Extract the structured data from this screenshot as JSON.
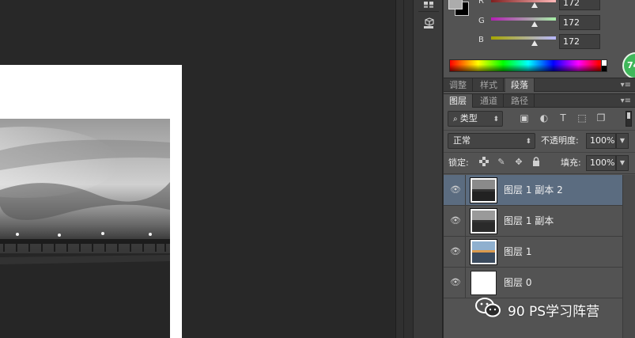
{
  "color_panel": {
    "foreground_color": "#acacac",
    "background_color": "#000000",
    "channels": [
      {
        "label": "R",
        "value": "172",
        "track_from": "#7f1f1f",
        "track_to": "#ffb8b8",
        "level": 0.674
      },
      {
        "label": "G",
        "value": "172",
        "track_from": "#b31fb3",
        "track_to": "#a6f0a6",
        "level": 0.674
      },
      {
        "label": "B",
        "value": "172",
        "track_from": "#a6a600",
        "track_to": "#b8b8ff",
        "level": 0.674
      }
    ],
    "badge_text": "74"
  },
  "adjust_tabs": [
    {
      "label": "调整",
      "active": false
    },
    {
      "label": "样式",
      "active": false
    },
    {
      "label": "段落",
      "active": true
    }
  ],
  "layer_tabs": [
    {
      "label": "图层",
      "active": true
    },
    {
      "label": "通道",
      "active": false
    },
    {
      "label": "路径",
      "active": false
    }
  ],
  "layers_controls": {
    "filter_label": "类型",
    "blend_mode": "正常",
    "opacity_label": "不透明度:",
    "opacity_value": "100%",
    "lock_label": "锁定:",
    "fill_label": "填充:",
    "fill_value": "100%"
  },
  "layers": [
    {
      "name": "图层 1 副本 2",
      "selected": true,
      "thumb": "gray-pier",
      "visible": true
    },
    {
      "name": "图层 1 副本",
      "selected": false,
      "thumb": "gray-pier",
      "visible": true
    },
    {
      "name": "图层 1",
      "selected": false,
      "thumb": "color-pier",
      "visible": true
    },
    {
      "name": "图层 0",
      "selected": false,
      "thumb": "white",
      "visible": true
    }
  ],
  "watermark": {
    "text": "90 PS学习阵营",
    "icon": "wechat-icon"
  },
  "icons": {
    "eye": "eye-icon",
    "search": "search-icon",
    "lock_pixels": "checkerboard-icon",
    "brush": "brush-icon",
    "move": "move-icon",
    "lock": "lock-icon"
  }
}
